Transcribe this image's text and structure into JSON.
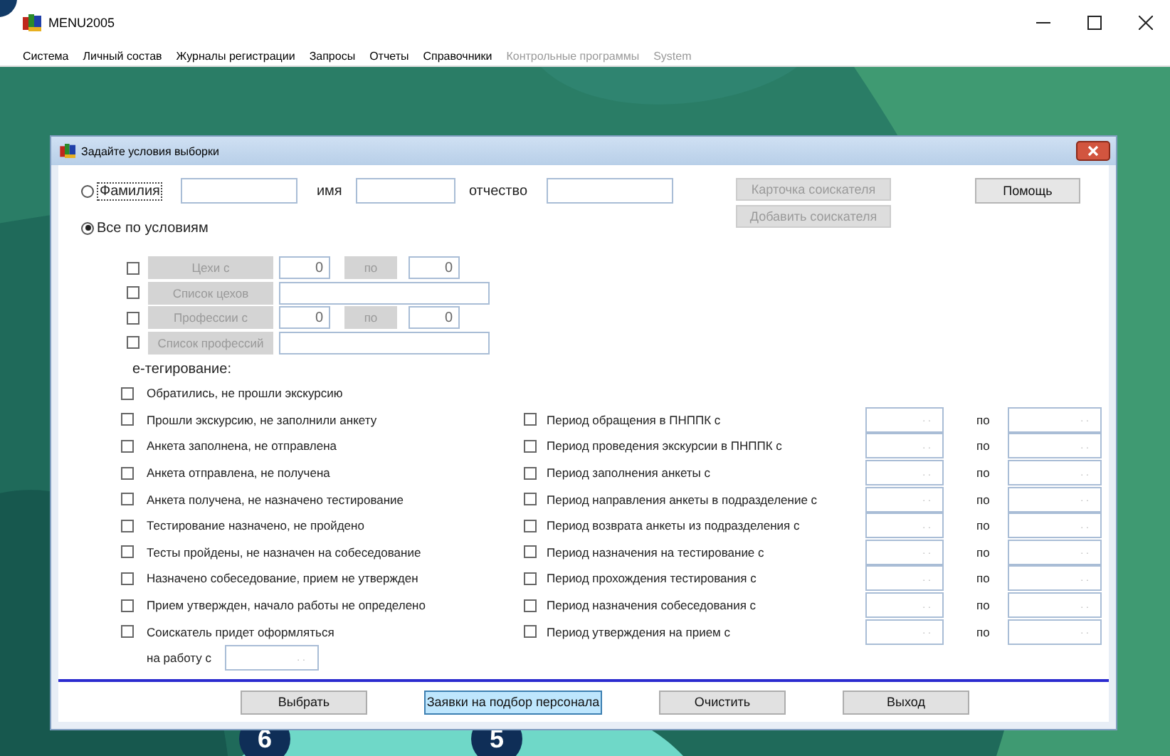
{
  "window": {
    "title": "MENU2005"
  },
  "menu": [
    {
      "label": "Система",
      "disabled": false
    },
    {
      "label": "Личный состав",
      "disabled": false
    },
    {
      "label": "Журналы регистрации",
      "disabled": false
    },
    {
      "label": "Запросы",
      "disabled": false
    },
    {
      "label": "Отчеты",
      "disabled": false
    },
    {
      "label": "Справочники",
      "disabled": false
    },
    {
      "label": "Контрольные программы",
      "disabled": true
    },
    {
      "label": "System",
      "disabled": true
    }
  ],
  "dialog": {
    "title": "Задайте условия выборки",
    "name_radio": {
      "label": "Фамилия",
      "selected": false
    },
    "name_labels": [
      "имя",
      "отчество"
    ],
    "side_buttons": [
      {
        "label": "Карточка соискателя",
        "disabled": true
      },
      {
        "label": "Добавить соискателя",
        "disabled": true
      }
    ],
    "help_button": {
      "label": "Помощь",
      "disabled": false
    },
    "all_radio": {
      "label": "Все по условиям",
      "selected": true
    },
    "filters": [
      {
        "kind": "range",
        "checked": false,
        "label": "Цехи  с",
        "from": "0",
        "to_label": "по",
        "to": "0"
      },
      {
        "kind": "list",
        "checked": false,
        "label": "Список цехов"
      },
      {
        "kind": "range",
        "checked": false,
        "label": "Профессии  с",
        "from": "0",
        "to_label": "по",
        "to": "0"
      },
      {
        "kind": "list",
        "checked": false,
        "label": "Список профессий"
      }
    ],
    "section_label": "е-тегирование:",
    "statuses": [
      {
        "label": "Обратились, не прошли экскурсию",
        "checked": false
      },
      {
        "label": "Прошли экскурсию, не заполнили анкету",
        "checked": false
      },
      {
        "label": "Анкета заполнена, не отправлена",
        "checked": false
      },
      {
        "label": "Анкета  отправлена, не получена",
        "checked": false
      },
      {
        "label": "Анкета  получена, не назначено тестирование",
        "checked": false
      },
      {
        "label": "Тестирование назначено, не пройдено",
        "checked": false
      },
      {
        "label": "Тесты пройдены, не назначен на собеседование",
        "checked": false
      },
      {
        "label": "Назначено собеседование, прием не утвержден",
        "checked": false
      },
      {
        "label": "Прием утвержден, начало работы не определено",
        "checked": false
      },
      {
        "label": "Соискатель придет оформляться",
        "checked": false
      }
    ],
    "start_label": "на работу с",
    "start_value": ". .",
    "periods": [
      {
        "label": "Период обращения в ПНППК с",
        "checked": false,
        "from": ". .",
        "to_label": "по",
        "to": ". ."
      },
      {
        "label": "Период проведения экскурсии в ПНППК с",
        "checked": false,
        "from": ". .",
        "to_label": "по",
        "to": ". ."
      },
      {
        "label": "Период  заполнения анкеты с",
        "checked": false,
        "from": ". .",
        "to_label": "по",
        "to": ". ."
      },
      {
        "label": "Период направления анкеты в подразделение с",
        "checked": false,
        "from": ". .",
        "to_label": "по",
        "to": ". ."
      },
      {
        "label": "Период возврата анкеты из подразделения с",
        "checked": false,
        "from": ". .",
        "to_label": "по",
        "to": ". ."
      },
      {
        "label": "Период назначения на тестирование с",
        "checked": false,
        "from": ". .",
        "to_label": "по",
        "to": ". ."
      },
      {
        "label": "Период прохождения тестирования с",
        "checked": false,
        "from": ". .",
        "to_label": "по",
        "to": ". ."
      },
      {
        "label": "Период назначения собеседования с",
        "checked": false,
        "from": ". .",
        "to_label": "по",
        "to": ". ."
      },
      {
        "label": "Период утверждения на прием с",
        "checked": false,
        "from": ". .",
        "to_label": "по",
        "to": ". ."
      }
    ],
    "buttons": [
      {
        "label": "Выбрать",
        "selected": false
      },
      {
        "label": "Заявки на подбор персонала",
        "selected": true
      },
      {
        "label": "Очистить",
        "selected": false
      },
      {
        "label": "Выход",
        "selected": false
      }
    ]
  },
  "callouts": [
    "6",
    "5"
  ]
}
